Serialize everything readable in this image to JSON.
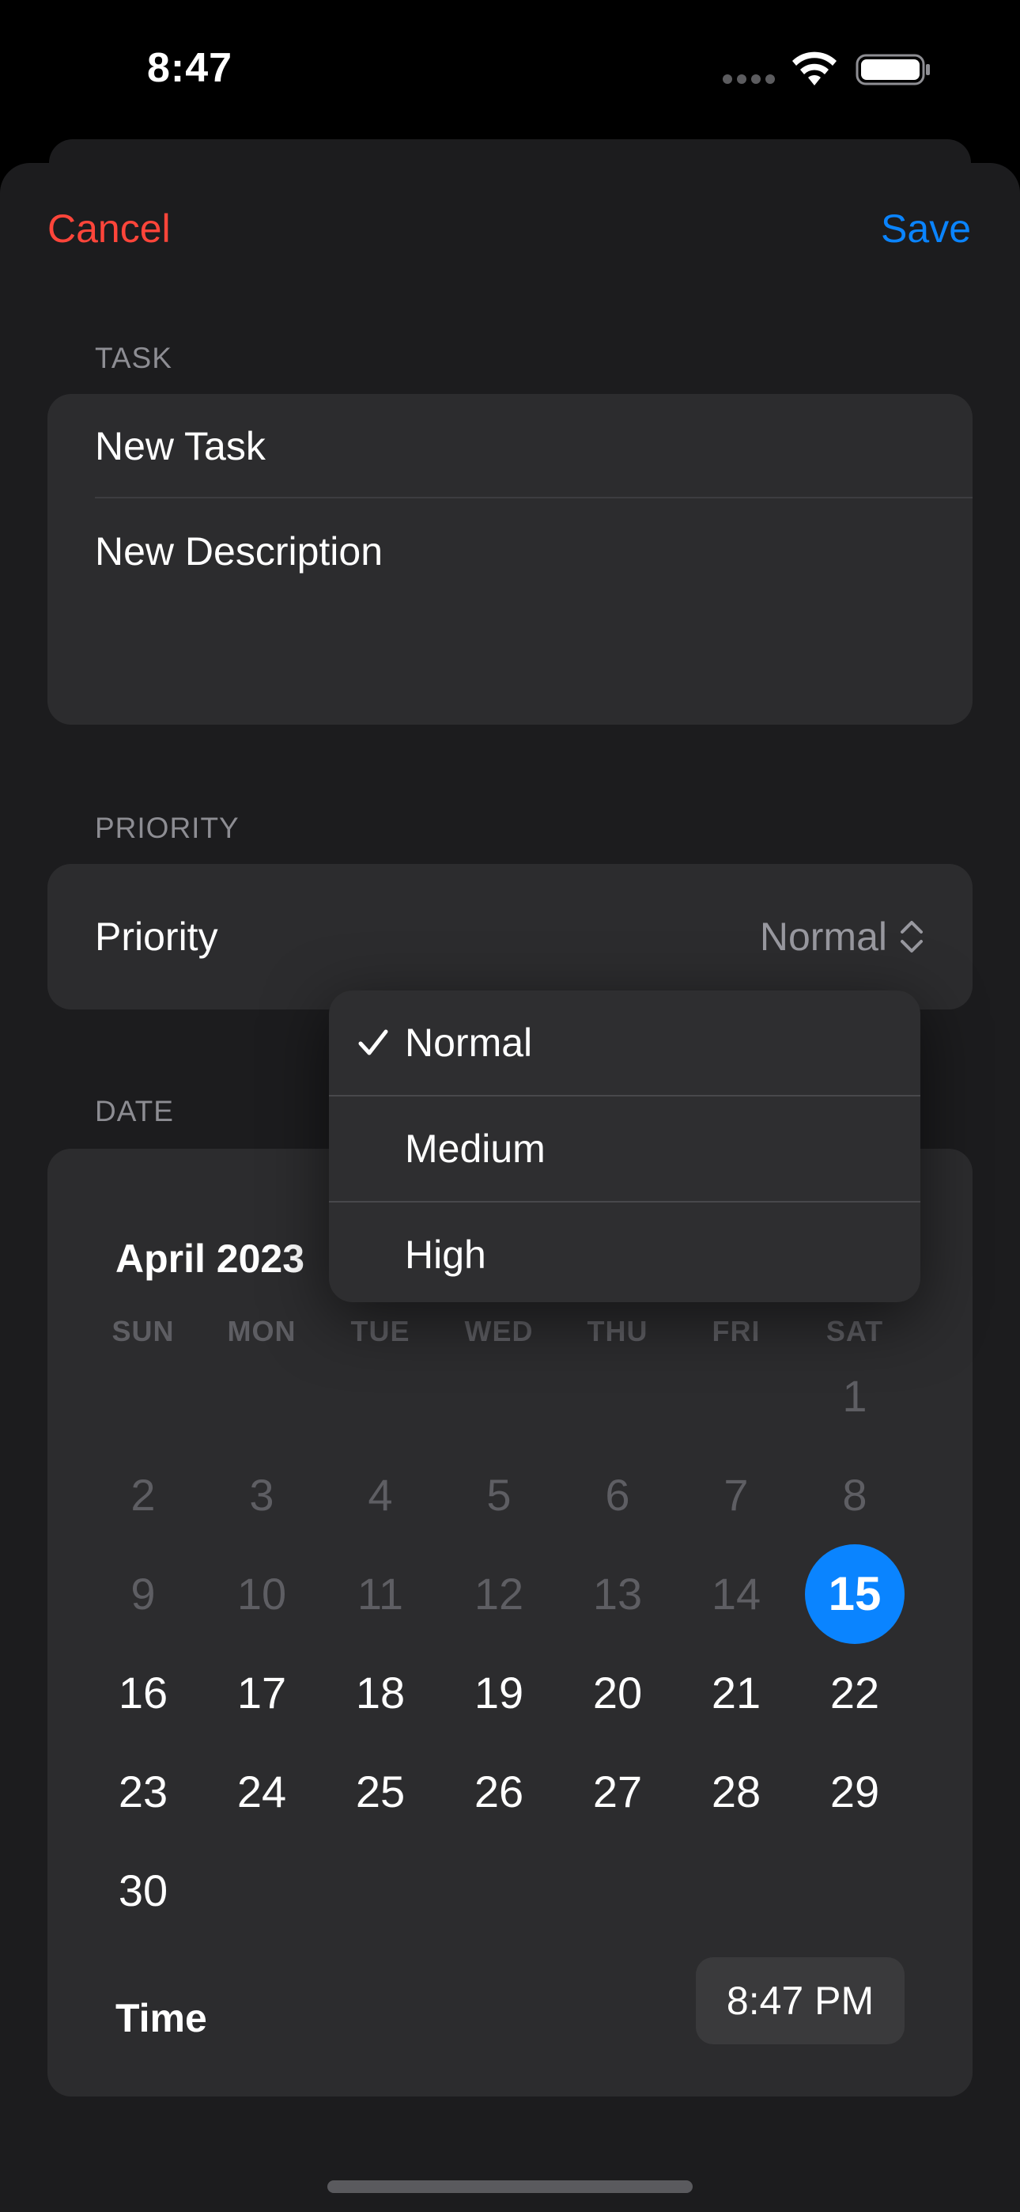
{
  "status_bar": {
    "time": "8:47"
  },
  "nav": {
    "cancel_label": "Cancel",
    "save_label": "Save"
  },
  "task_section": {
    "header": "TASK",
    "title": "New Task",
    "description": "New Description"
  },
  "priority_section": {
    "header": "PRIORITY",
    "label": "Priority",
    "value": "Normal",
    "menu": {
      "selected": "Normal",
      "options": [
        "Normal",
        "Medium",
        "High"
      ]
    }
  },
  "date_section": {
    "header": "DATE",
    "month_label": "April 2023",
    "weekdays": [
      "SUN",
      "MON",
      "TUE",
      "WED",
      "THU",
      "FRI",
      "SAT"
    ],
    "days": [
      "1",
      "2",
      "3",
      "4",
      "5",
      "6",
      "7",
      "8",
      "9",
      "10",
      "11",
      "12",
      "13",
      "14",
      "15",
      "16",
      "17",
      "18",
      "19",
      "20",
      "21",
      "22",
      "23",
      "24",
      "25",
      "26",
      "27",
      "28",
      "29",
      "30"
    ],
    "selected_day": "15",
    "time_label": "Time",
    "time_value": "8:47 PM"
  },
  "colors": {
    "destructive": "#ff453a",
    "accent": "#0a84ff",
    "group_background": "#2c2c2e",
    "sheet_background": "#1c1c1e"
  }
}
